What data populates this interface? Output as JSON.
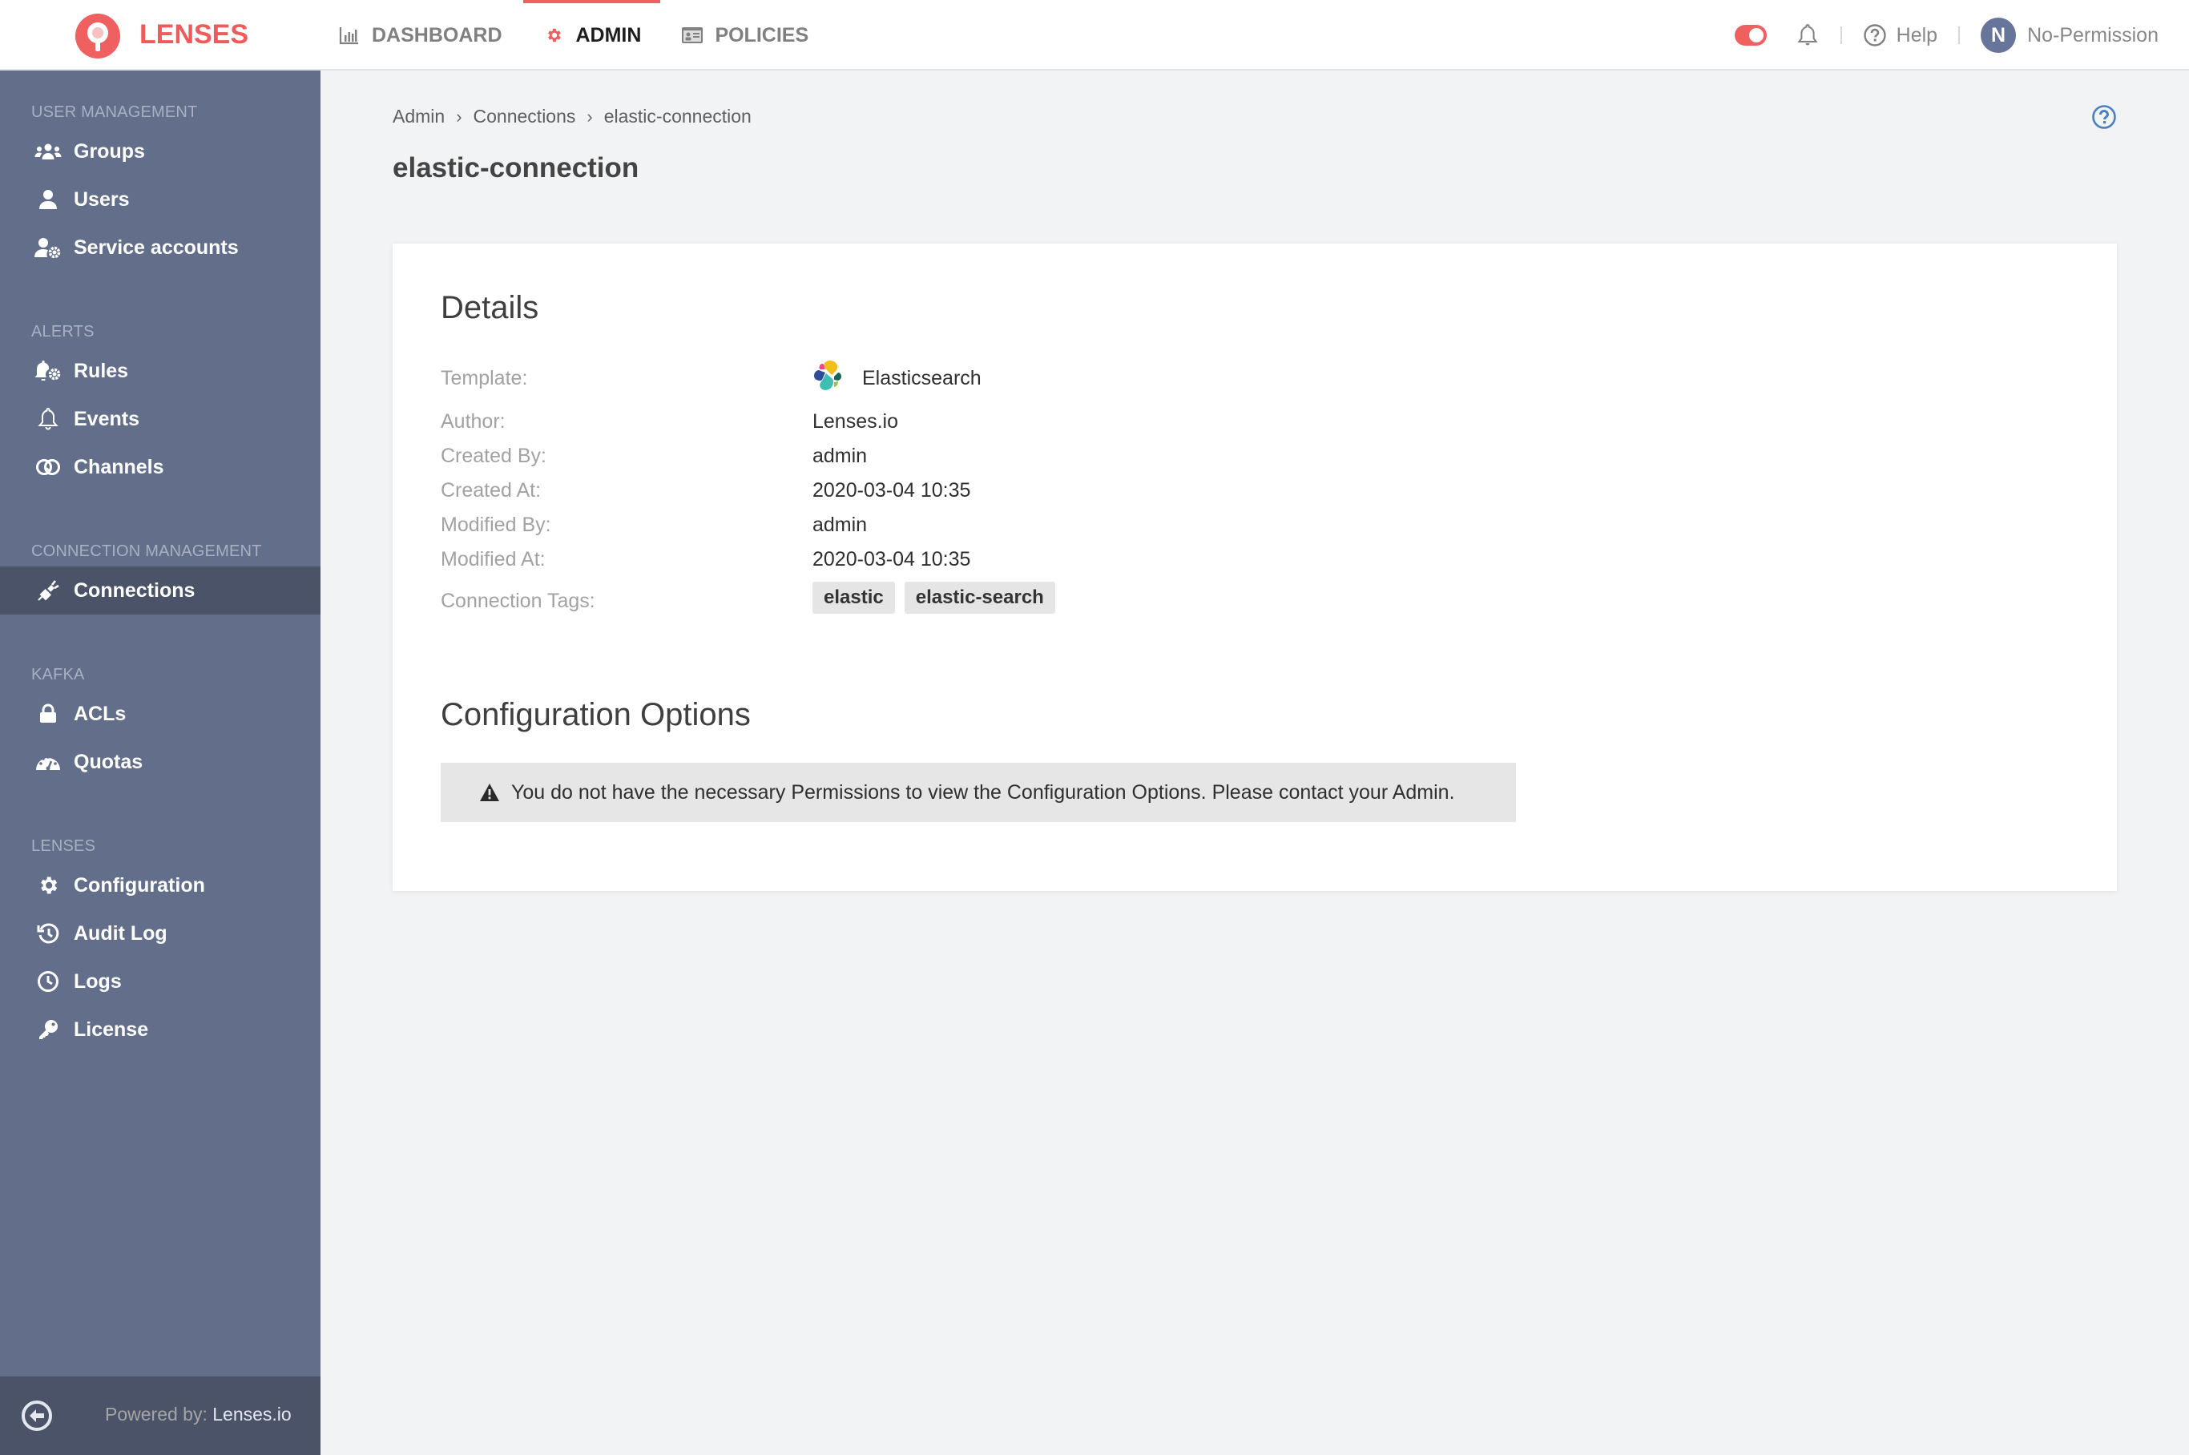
{
  "header": {
    "brand": "LENSES",
    "nav": [
      {
        "label": "DASHBOARD",
        "icon": "bar-chart-icon",
        "active": false
      },
      {
        "label": "ADMIN",
        "icon": "gear-icon",
        "active": true
      },
      {
        "label": "POLICIES",
        "icon": "id-card-icon",
        "active": false
      }
    ],
    "help_label": "Help",
    "user_initial": "N",
    "user_name": "No-Permission"
  },
  "sidebar": {
    "sections": [
      {
        "title": "USER MANAGEMENT",
        "items": [
          {
            "label": "Groups",
            "icon": "users-icon"
          },
          {
            "label": "Users",
            "icon": "user-icon"
          },
          {
            "label": "Service accounts",
            "icon": "user-gear-icon"
          }
        ]
      },
      {
        "title": "ALERTS",
        "items": [
          {
            "label": "Rules",
            "icon": "bell-gear-icon"
          },
          {
            "label": "Events",
            "icon": "bell-icon"
          },
          {
            "label": "Channels",
            "icon": "channels-icon"
          }
        ]
      },
      {
        "title": "CONNECTION MANAGEMENT",
        "items": [
          {
            "label": "Connections",
            "icon": "plug-icon",
            "active": true
          }
        ]
      },
      {
        "title": "KAFKA",
        "items": [
          {
            "label": "ACLs",
            "icon": "lock-icon"
          },
          {
            "label": "Quotas",
            "icon": "gauge-icon"
          }
        ]
      },
      {
        "title": "LENSES",
        "items": [
          {
            "label": "Configuration",
            "icon": "gear-icon"
          },
          {
            "label": "Audit Log",
            "icon": "history-icon"
          },
          {
            "label": "Logs",
            "icon": "clock-icon"
          },
          {
            "label": "License",
            "icon": "key-icon"
          }
        ]
      }
    ],
    "footer": {
      "powered_prefix": "Powered by:",
      "powered_name": "Lenses.io"
    }
  },
  "breadcrumb": [
    "Admin",
    "Connections",
    "elastic-connection"
  ],
  "page_title": "elastic-connection",
  "details": {
    "title": "Details",
    "rows": [
      {
        "label": "Template:",
        "value": "Elasticsearch"
      },
      {
        "label": "Author:",
        "value": "Lenses.io"
      },
      {
        "label": "Created By:",
        "value": "admin"
      },
      {
        "label": "Created At:",
        "value": "2020-03-04 10:35"
      },
      {
        "label": "Modified By:",
        "value": "admin"
      },
      {
        "label": "Modified At:",
        "value": "2020-03-04 10:35"
      }
    ],
    "tags_label": "Connection Tags:",
    "tags": [
      "elastic",
      "elastic-search"
    ]
  },
  "config": {
    "title": "Configuration Options",
    "alert": "You do not have the necessary Permissions to view the Configuration Options. Please contact your Admin."
  },
  "colors": {
    "accent": "#f06060",
    "sidebar_bg": "#636e8a",
    "sidebar_active": "#4b5369",
    "help_icon": "#4a80c0"
  }
}
